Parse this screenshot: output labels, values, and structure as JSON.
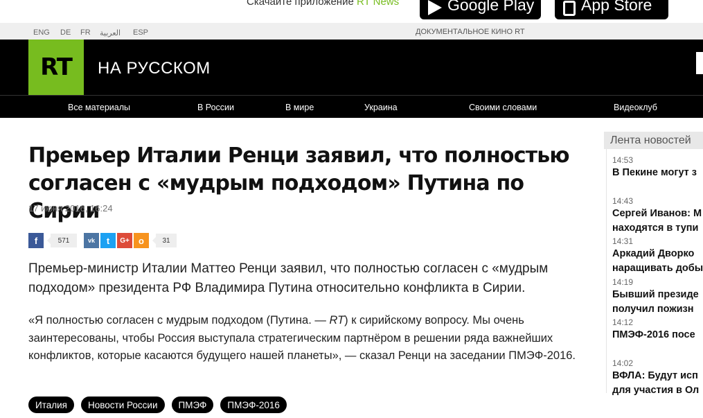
{
  "promo": {
    "text": "Скачайте приложение ",
    "brand": "RT News",
    "google_play": "Google Play",
    "app_store": "App Store"
  },
  "languages": [
    "ENG",
    "DE",
    "FR",
    "العربية",
    "ESP"
  ],
  "doc_link": "ДОКУМЕНТАЛЬНОЕ КИНО RT",
  "header": {
    "logo": "RT",
    "site_title": "НА РУССКОМ"
  },
  "nav": [
    "Все материалы",
    "В России",
    "В мире",
    "Украина",
    "Своими словами",
    "Видеоклуб"
  ],
  "article": {
    "title": "Премьер Италии Ренци заявил, что полностью согласен с «мудрым подходом» Путина по Сирии",
    "date": "17 июня 2016, 16:24",
    "share": {
      "facebook_count": "571",
      "odnoklassniki_count": "31"
    },
    "lead": "Премьер-министр Италии Маттео Ренци заявил, что полностью согласен с «мудрым подходом» президента РФ Владимира Путина относительно конфликта в Сирии.",
    "body_before": "«Я полностью согласен с мудрым подходом (Путина. — ",
    "body_em": "RT",
    "body_after": ") к сирийскому вопросу. Мы очень заинтересованы, чтобы Россия выступала стратегическим партнёром в решении ряда важнейших конфликтов, которые касаются будущего нашей планеты», — сказал Ренци на заседании ПМЭФ-2016.",
    "tags": [
      "Италия",
      "Новости России",
      "ПМЭФ",
      "ПМЭФ-2016"
    ]
  },
  "feed": {
    "title": "Лента новостей",
    "items": [
      {
        "time": "14:53",
        "text": "В Пекине могут з"
      },
      {
        "time": "14:43",
        "text": "Сергей Иванов: М\nнаходятся в тупи"
      },
      {
        "time": "14:31",
        "text": "Аркадий Дворко\nнаращивать добы"
      },
      {
        "time": "14:19",
        "text": "Бывший президе\nполучил пожизн"
      },
      {
        "time": "14:12",
        "text": "ПМЭФ-2016 посе"
      },
      {
        "time": "14:02",
        "text": "ВФЛА: Будут исп\nдля участия в Ол"
      }
    ]
  },
  "colors": {
    "brand_green": "#77bc1f",
    "facebook": "#3b5998",
    "vk": "#4c75a3",
    "twitter": "#1da1f2",
    "google_plus": "#dd4b39",
    "odnoklassniki": "#f7931e"
  },
  "icons": [
    "google-play-icon",
    "app-store-icon",
    "facebook-icon",
    "vk-icon",
    "twitter-icon",
    "google-plus-icon",
    "odnoklassniki-icon"
  ]
}
